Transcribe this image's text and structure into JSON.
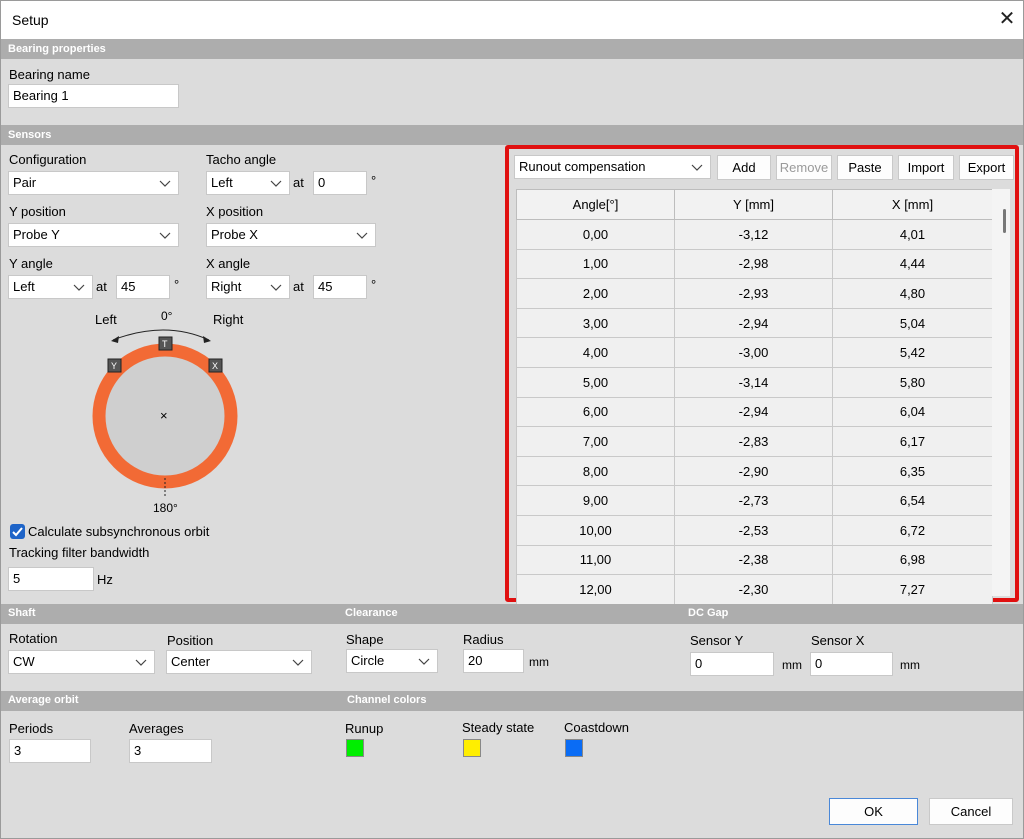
{
  "window": {
    "title": "Setup"
  },
  "sections": {
    "bearing_properties": "Bearing properties",
    "sensors": "Sensors",
    "shaft": "Shaft",
    "clearance": "Clearance",
    "dc_gap": "DC Gap",
    "average_orbit": "Average orbit",
    "channel_colors": "Channel colors"
  },
  "bearing": {
    "name_label": "Bearing name",
    "name_value": "Bearing 1"
  },
  "sensors": {
    "configuration_label": "Configuration",
    "configuration_value": "Pair",
    "tacho_label": "Tacho angle",
    "tacho_value": "Left",
    "tacho_at": "at",
    "tacho_angle": "0",
    "y_position_label": "Y position",
    "y_position_value": "Probe Y",
    "x_position_label": "X position",
    "x_position_value": "Probe X",
    "y_angle_label": "Y angle",
    "y_angle_value": "Left",
    "y_at": "at",
    "y_angle": "45",
    "x_angle_label": "X angle",
    "x_angle_value": "Right",
    "x_at": "at",
    "x_angle": "45",
    "degree": "°",
    "diagram": {
      "left": "Left",
      "right": "Right",
      "top": "0°",
      "bottom": "180°",
      "tag_t": "T",
      "tag_y": "Y",
      "tag_x": "X",
      "center": "×",
      "ring_color": "#f26a35"
    },
    "subsync_label": "Calculate subsynchronous orbit",
    "subsync_checked": true,
    "tracking_label": "Tracking filter bandwidth",
    "tracking_value": "5",
    "tracking_unit": "Hz"
  },
  "runout": {
    "mode": "Runout compensation",
    "buttons": {
      "add": "Add",
      "remove": "Remove",
      "paste": "Paste",
      "import": "Import",
      "export": "Export"
    },
    "columns": [
      "Angle[°]",
      "Y [mm]",
      "X [mm]"
    ],
    "rows": [
      [
        "0,00",
        "-3,12",
        "4,01"
      ],
      [
        "1,00",
        "-2,98",
        "4,44"
      ],
      [
        "2,00",
        "-2,93",
        "4,80"
      ],
      [
        "3,00",
        "-2,94",
        "5,04"
      ],
      [
        "4,00",
        "-3,00",
        "5,42"
      ],
      [
        "5,00",
        "-3,14",
        "5,80"
      ],
      [
        "6,00",
        "-2,94",
        "6,04"
      ],
      [
        "7,00",
        "-2,83",
        "6,17"
      ],
      [
        "8,00",
        "-2,90",
        "6,35"
      ],
      [
        "9,00",
        "-2,73",
        "6,54"
      ],
      [
        "10,00",
        "-2,53",
        "6,72"
      ],
      [
        "11,00",
        "-2,38",
        "6,98"
      ],
      [
        "12,00",
        "-2,30",
        "7,27"
      ]
    ],
    "highlight_color": "#e01010"
  },
  "shaft": {
    "rotation_label": "Rotation",
    "rotation_value": "CW",
    "position_label": "Position",
    "position_value": "Center"
  },
  "clearance": {
    "shape_label": "Shape",
    "shape_value": "Circle",
    "radius_label": "Radius",
    "radius_value": "20",
    "radius_unit": "mm"
  },
  "dc_gap": {
    "sensor_y_label": "Sensor Y",
    "sensor_y_value": "0",
    "sensor_y_unit": "mm",
    "sensor_x_label": "Sensor X",
    "sensor_x_value": "0",
    "sensor_x_unit": "mm"
  },
  "average_orbit": {
    "periods_label": "Periods",
    "periods_value": "3",
    "averages_label": "Averages",
    "averages_value": "3"
  },
  "channel_colors": {
    "runup_label": "Runup",
    "runup_color": "#00ee00",
    "steady_label": "Steady state",
    "steady_color": "#ffee00",
    "coastdown_label": "Coastdown",
    "coastdown_color": "#0a6cf5"
  },
  "footer": {
    "ok": "OK",
    "cancel": "Cancel"
  }
}
